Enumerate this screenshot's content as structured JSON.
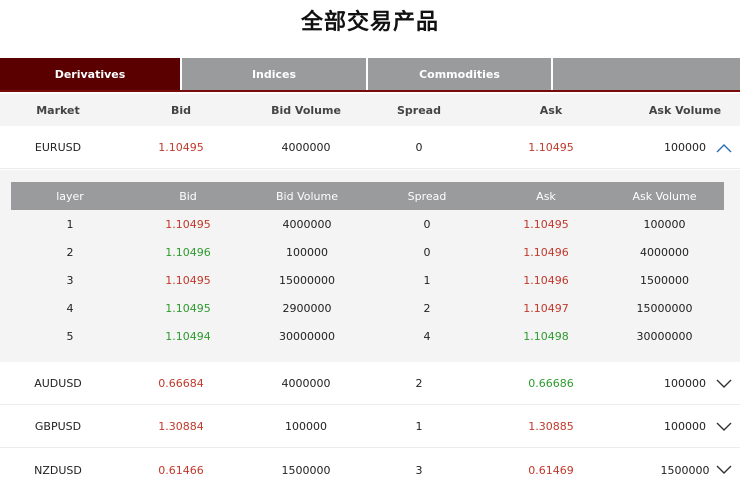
{
  "page": {
    "title": "全部交易产品"
  },
  "tabs": [
    {
      "label": "Derivatives",
      "active": true
    },
    {
      "label": "Indices",
      "active": false
    },
    {
      "label": "Commodities",
      "active": false
    },
    {
      "label": "",
      "active": false
    }
  ],
  "table": {
    "headers": [
      "Market",
      "Bid",
      "Bid Volume",
      "Spread",
      "Ask",
      "Ask Volume"
    ],
    "rows": [
      {
        "market": "EURUSD",
        "bid": "1.10495",
        "bid_volume": "4000000",
        "spread": "0",
        "ask": "1.10495",
        "ask_volume": "100000",
        "expanded": true
      },
      {
        "market": "AUDUSD",
        "bid": "0.66684",
        "bid_volume": "4000000",
        "spread": "2",
        "ask": "0.66686",
        "ask_volume": "100000",
        "expanded": false
      },
      {
        "market": "GBPUSD",
        "bid": "1.30884",
        "bid_volume": "100000",
        "spread": "1",
        "ask": "1.30885",
        "ask_volume": "100000",
        "expanded": false
      },
      {
        "market": "NZDUSD",
        "bid": "0.61466",
        "bid_volume": "1500000",
        "spread": "3",
        "ask": "0.61469",
        "ask_volume": "1500000",
        "expanded": false
      }
    ]
  },
  "depth": {
    "headers": [
      "layer",
      "Bid",
      "Bid Volume",
      "Spread",
      "Ask",
      "Ask Volume"
    ],
    "rows": [
      {
        "layer": "1",
        "bid": "1.10495",
        "bid_volume": "4000000",
        "spread": "0",
        "ask": "1.10495",
        "ask_volume": "100000"
      },
      {
        "layer": "2",
        "bid": "1.10496",
        "bid_volume": "100000",
        "spread": "0",
        "ask": "1.10496",
        "ask_volume": "4000000"
      },
      {
        "layer": "3",
        "bid": "1.10495",
        "bid_volume": "15000000",
        "spread": "1",
        "ask": "1.10496",
        "ask_volume": "1500000"
      },
      {
        "layer": "4",
        "bid": "1.10495",
        "bid_volume": "2900000",
        "spread": "2",
        "ask": "1.10497",
        "ask_volume": "15000000"
      },
      {
        "layer": "5",
        "bid": "1.10494",
        "bid_volume": "30000000",
        "spread": "4",
        "ask": "1.10498",
        "ask_volume": "30000000"
      }
    ]
  },
  "colors": {
    "accent": "#5a0000",
    "tab_inactive": "#9a9b9d",
    "price_down": "#c0392b",
    "price_up": "#2e9a2e",
    "chevron": "#2a6db3"
  },
  "icons": {
    "expand": "chevron-down-icon",
    "collapse": "chevron-up-icon"
  }
}
